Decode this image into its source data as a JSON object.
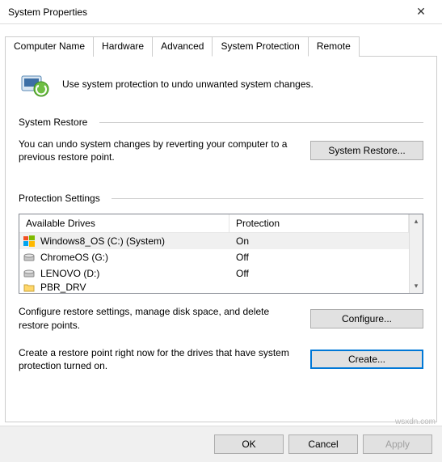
{
  "window": {
    "title": "System Properties"
  },
  "tabs": [
    {
      "label": "Computer Name"
    },
    {
      "label": "Hardware"
    },
    {
      "label": "Advanced"
    },
    {
      "label": "System Protection"
    },
    {
      "label": "Remote"
    }
  ],
  "intro": "Use system protection to undo unwanted system changes.",
  "restore": {
    "heading": "System Restore",
    "desc": "You can undo system changes by reverting your computer to a previous restore point.",
    "button": "System Restore..."
  },
  "protection": {
    "heading": "Protection Settings",
    "columns": {
      "c1": "Available Drives",
      "c2": "Protection"
    },
    "drives": [
      {
        "name": "Windows8_OS (C:) (System)",
        "protection": "On",
        "icon": "windows"
      },
      {
        "name": "ChromeOS (G:)",
        "protection": "Off",
        "icon": "disk"
      },
      {
        "name": "LENOVO (D:)",
        "protection": "Off",
        "icon": "disk"
      },
      {
        "name": "PBR_DRV",
        "protection": "",
        "icon": "folder"
      }
    ],
    "configure": {
      "desc": "Configure restore settings, manage disk space, and delete restore points.",
      "button": "Configure..."
    },
    "create": {
      "desc": "Create a restore point right now for the drives that have system protection turned on.",
      "button": "Create..."
    }
  },
  "footer": {
    "ok": "OK",
    "cancel": "Cancel",
    "apply": "Apply"
  },
  "watermark": "wsxdn.com"
}
